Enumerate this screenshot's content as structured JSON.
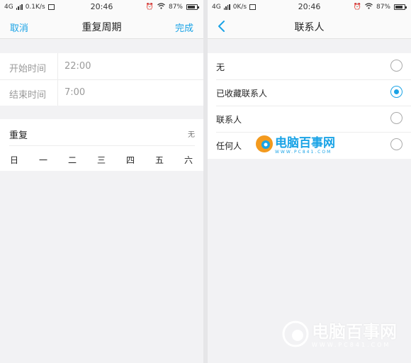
{
  "left": {
    "status": {
      "network": "4G",
      "speed": "0.1K/s",
      "time": "20:46",
      "battery": "87%",
      "battery_level": 0.87
    },
    "nav": {
      "cancel": "取消",
      "title": "重复周期",
      "done": "完成"
    },
    "time_rows": [
      {
        "label": "开始时间",
        "value": "22:00"
      },
      {
        "label": "结束时间",
        "value": "7:00"
      }
    ],
    "repeat": {
      "label": "重复",
      "value": "无",
      "days": [
        "日",
        "一",
        "二",
        "三",
        "四",
        "五",
        "六"
      ]
    }
  },
  "right": {
    "status": {
      "network": "4G",
      "speed": "0K/s",
      "time": "20:46",
      "battery": "87%",
      "battery_level": 0.87
    },
    "nav": {
      "title": "联系人"
    },
    "options": [
      {
        "label": "无",
        "selected": false
      },
      {
        "label": "已收藏联系人",
        "selected": true
      },
      {
        "label": "联系人",
        "selected": false
      },
      {
        "label": "任何人",
        "selected": false
      }
    ]
  },
  "watermark": {
    "name": "电脑百事网",
    "url": "WWW.PC841.COM"
  },
  "colors": {
    "accent": "#1aa3e6",
    "watermark_orange": "#f39a1e"
  }
}
